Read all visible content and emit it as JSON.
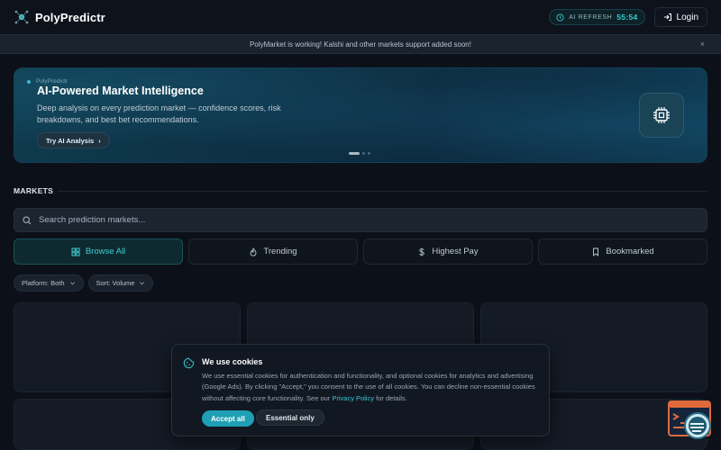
{
  "header": {
    "brand": "PolyPredictr",
    "ai_refresh_label": "AI REFRESH",
    "ai_refresh_timer": "55:54",
    "login_label": "Login"
  },
  "announcement": {
    "text": "PolyMarket is working! Kalshi and other markets support added soon!",
    "close": "×"
  },
  "hero": {
    "tag": "PolyPredictr",
    "title": "AI-Powered Market Intelligence",
    "description": "Deep analysis on every prediction market — confidence scores, risk breakdowns, and best bet recommendations.",
    "button_label": "Try AI Analysis",
    "button_arrow": "›"
  },
  "markets": {
    "heading": "MARKETS",
    "search_placeholder": "Search prediction markets...",
    "tabs": [
      {
        "label": "Browse All",
        "icon": "grid-icon",
        "active": true
      },
      {
        "label": "Trending",
        "icon": "flame-icon",
        "active": false
      },
      {
        "label": "Highest Pay",
        "icon": "dollar-icon",
        "active": false
      },
      {
        "label": "Bookmarked",
        "icon": "bookmark-icon",
        "active": false
      }
    ],
    "filters": [
      {
        "label": "Platform: Both"
      },
      {
        "label": "Sort: Volume"
      }
    ]
  },
  "cookie": {
    "title": "We use cookies",
    "text_before_link": "We use essential cookies for authentication and functionality, and optional cookies for analytics and advertising (Google Ads). By clicking \"Accept,\" you consent to the use of all cookies. You can decline non-essential cookies without affecting core functionality. See our ",
    "link": "Privacy Policy",
    "text_after_link": " for details.",
    "accept_label": "Accept all",
    "essential_label": "Essential only"
  },
  "colors": {
    "accent": "#3fd0d6",
    "background": "#0c1119",
    "accept_button": "#1f9fb3"
  }
}
